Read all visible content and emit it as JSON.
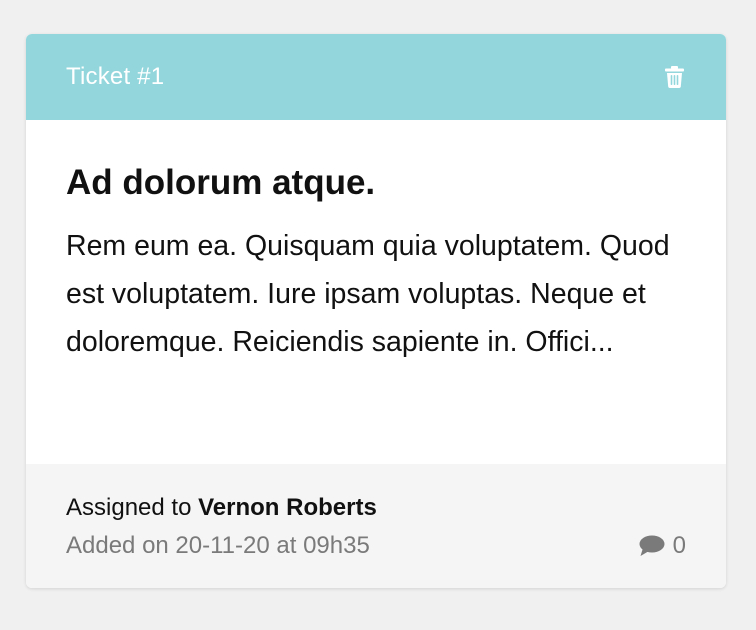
{
  "ticket": {
    "header_label": "Ticket #1",
    "title": "Ad dolorum atque.",
    "description": "Rem eum ea. Quisquam quia voluptatem. Quod est voluptatem. Iure ipsam voluptas. Neque et doloremque. Reiciendis sapiente in. Offici...",
    "assigned_prefix": "Assigned to",
    "assignee": "Vernon Roberts",
    "added_on": "Added on 20-11-20 at 09h35",
    "comment_count": "0"
  },
  "icons": {
    "delete": "trash-icon",
    "comments": "comment-icon"
  },
  "colors": {
    "header_bg": "#93d7dd",
    "header_text": "#ffffff",
    "footer_bg": "#f5f5f5",
    "muted_text": "#7a7a7a",
    "page_bg": "#f0f0f0"
  }
}
